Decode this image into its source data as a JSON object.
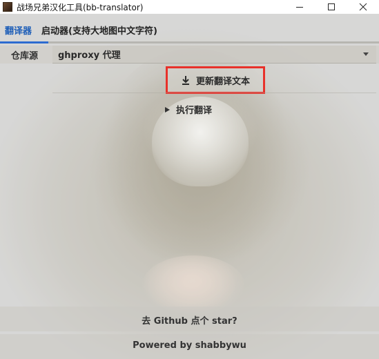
{
  "window": {
    "title": "战场兄弟汉化工具(bb-translator)"
  },
  "tabs": [
    {
      "label": "翻译器",
      "active": true
    },
    {
      "label": "启动器(支持大地图中文字符)",
      "active": false
    }
  ],
  "repo": {
    "label": "仓库源",
    "selected": "ghproxy 代理"
  },
  "actions": {
    "update_label": "更新翻译文本",
    "execute_label": "执行翻译"
  },
  "footer": {
    "star_text": "去 Github 点个 star?",
    "powered_text": "Powered by shabbywu"
  },
  "colors": {
    "accent": "#1f5fb8",
    "highlight": "#e8312a"
  }
}
